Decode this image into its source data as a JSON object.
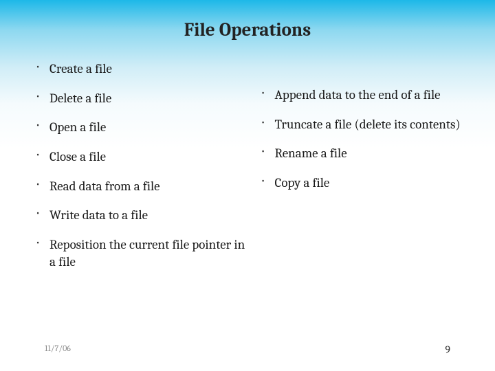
{
  "title": "File Operations",
  "left_items": [
    "Create a file",
    "Delete a file",
    "Open a file",
    "Close a file",
    "Read data from a file",
    "Write data to a file",
    "Reposition the current file pointer in a file"
  ],
  "right_items": [
    "Append data to the end of a file",
    "Truncate a file (delete its contents)",
    "Rename a file",
    "Copy a file"
  ],
  "footer": {
    "date": "11/7/06",
    "page": "9"
  }
}
